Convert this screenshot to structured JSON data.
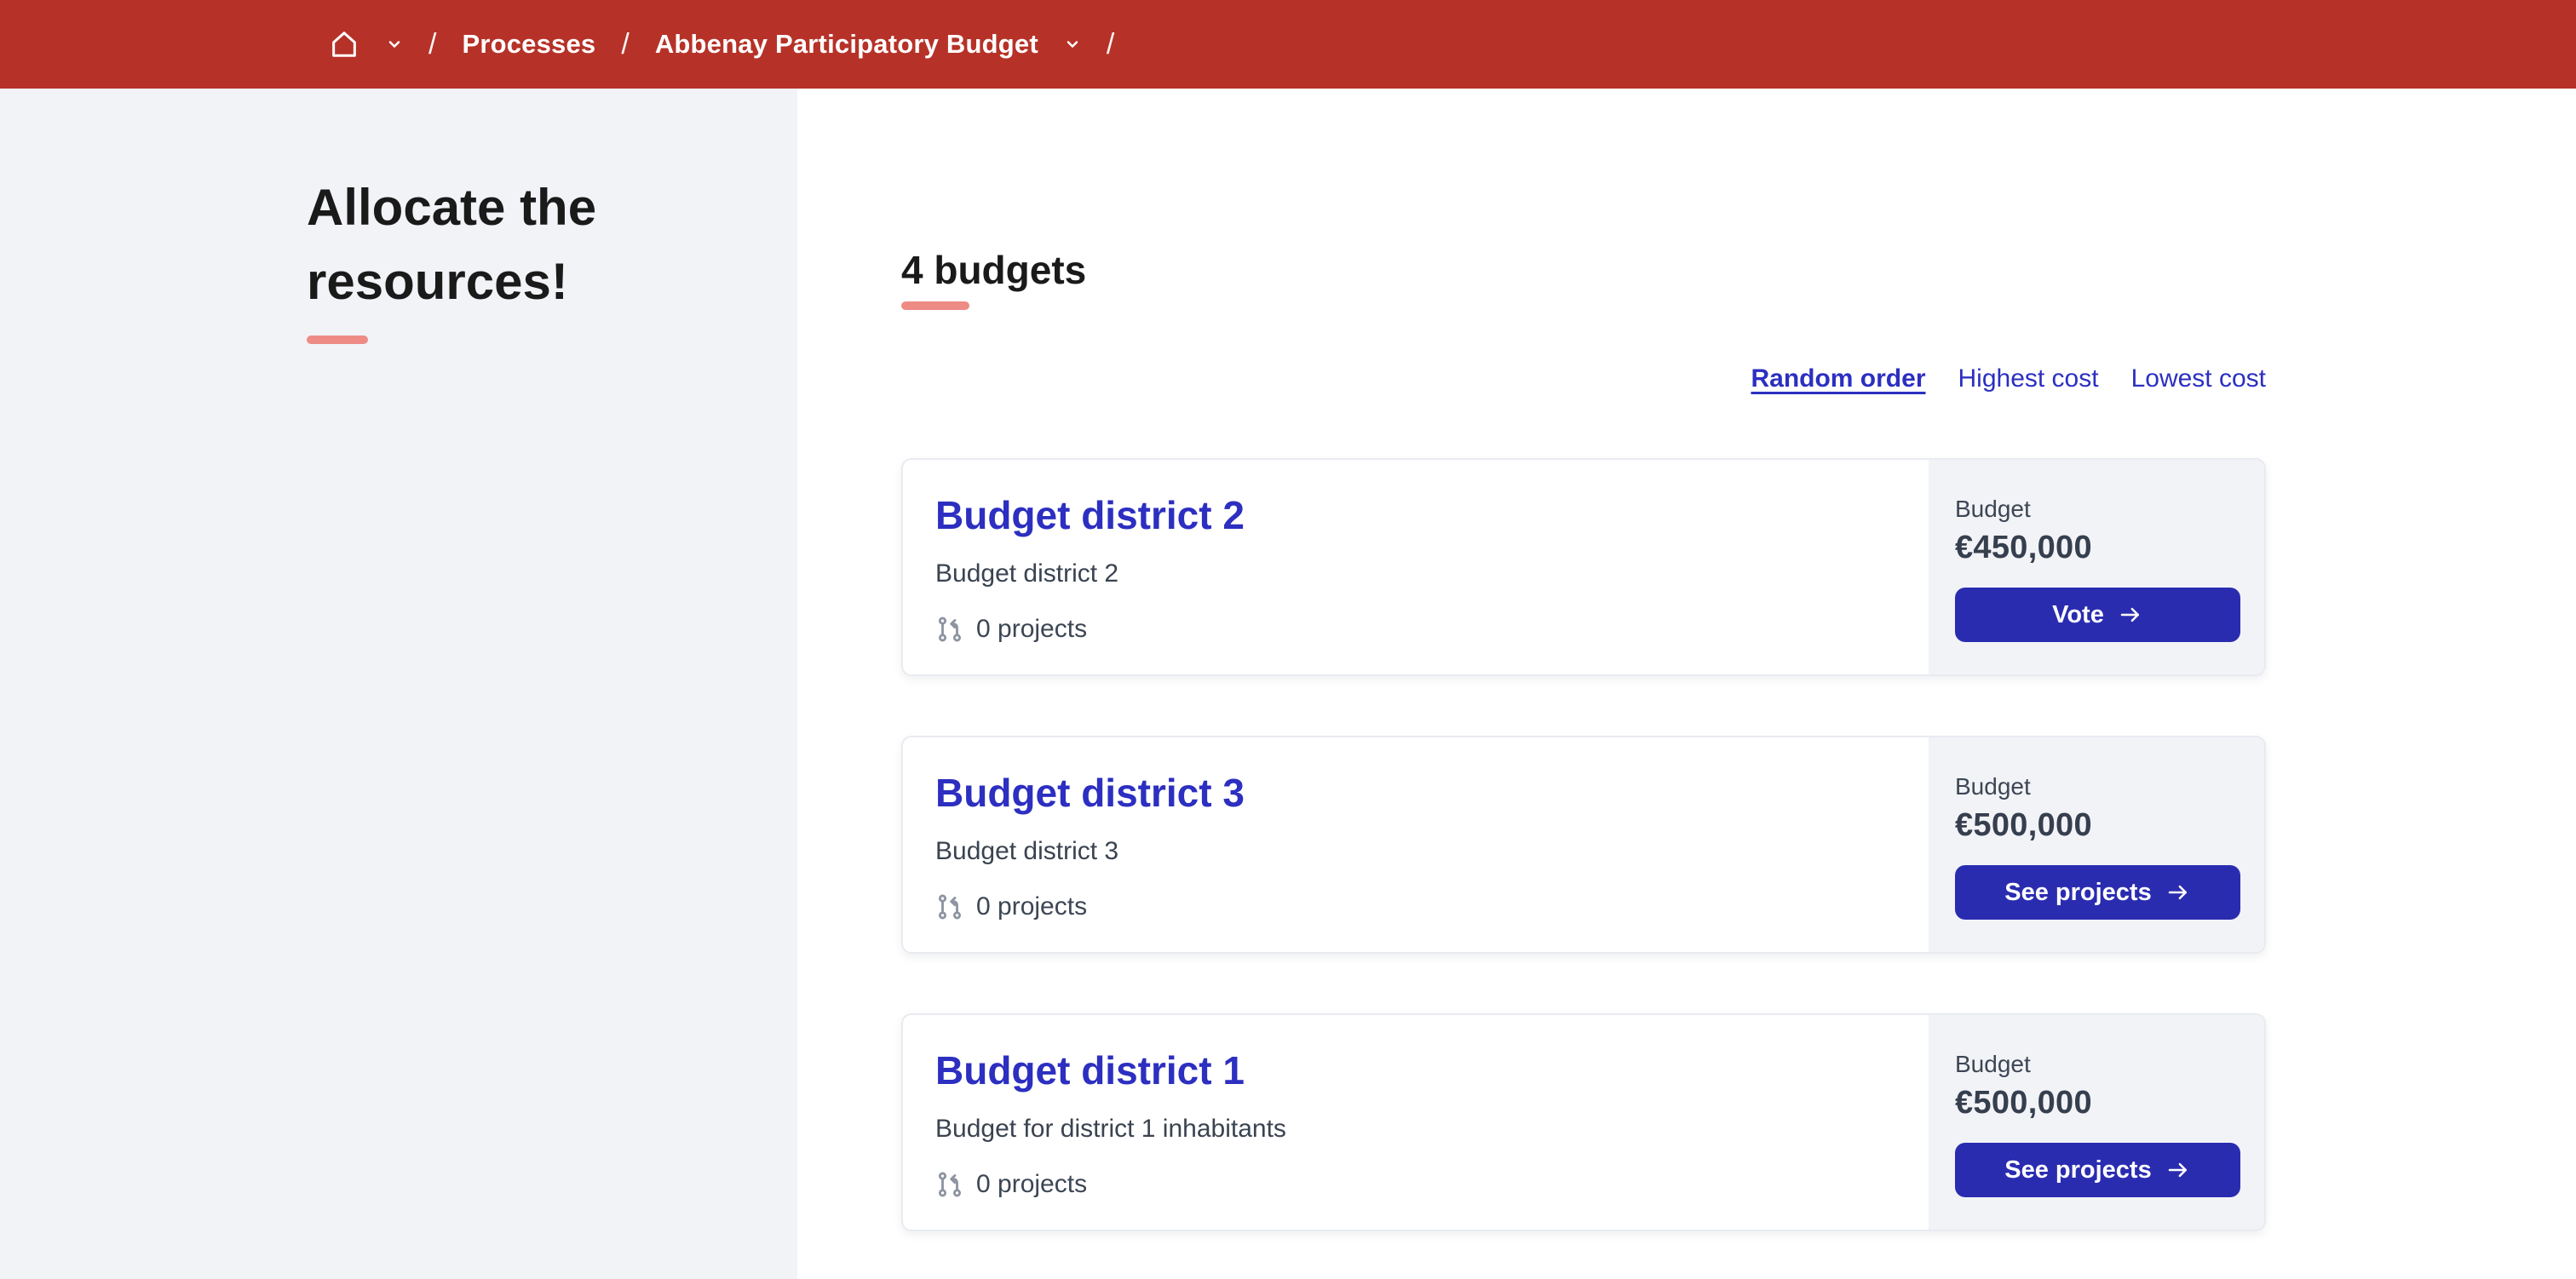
{
  "theme": {
    "header-bg": "#b63228",
    "sidebar-bg": "#f2f3f7",
    "panel-bg": "#f2f3f7",
    "accent": "#ee8b85",
    "link-blue": "#2c2fc0",
    "button-bg": "#2a2cb0"
  },
  "breadcrumb": {
    "separator": "/",
    "items": [
      {
        "label": "Processes"
      },
      {
        "label": "Abbenay Participatory Budget"
      }
    ]
  },
  "sidebar": {
    "title": "Allocate the resources!"
  },
  "main": {
    "heading": "4 budgets",
    "sort": {
      "options": [
        {
          "label": "Random order",
          "active": true
        },
        {
          "label": "Highest cost",
          "active": false
        },
        {
          "label": "Lowest cost",
          "active": false
        }
      ]
    },
    "cards": [
      {
        "title": "Budget district 2",
        "description": "Budget district 2",
        "projects": "0 projects",
        "budget_label": "Budget",
        "amount": "€450,000",
        "action": "Vote"
      },
      {
        "title": "Budget district 3",
        "description": "Budget district 3",
        "projects": "0 projects",
        "budget_label": "Budget",
        "amount": "€500,000",
        "action": "See projects"
      },
      {
        "title": "Budget district 1",
        "description": "Budget for district 1 inhabitants",
        "projects": "0 projects",
        "budget_label": "Budget",
        "amount": "€500,000",
        "action": "See projects"
      }
    ]
  }
}
